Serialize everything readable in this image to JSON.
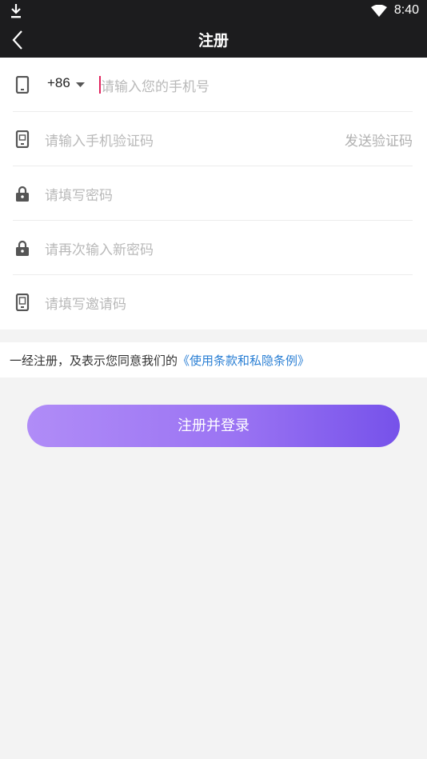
{
  "status_bar": {
    "time": "8:40",
    "icons": [
      "download-icon",
      "wifi-icon"
    ]
  },
  "header": {
    "title": "注册",
    "back_icon": "chevron-left-icon"
  },
  "form": {
    "phone": {
      "icon": "phone-icon",
      "country_code": "+86",
      "placeholder": "请输入您的手机号"
    },
    "sms_code": {
      "icon": "sms-code-icon",
      "placeholder": "请输入手机验证码",
      "send_label": "发送验证码"
    },
    "password": {
      "icon": "lock-icon",
      "placeholder": "请填写密码"
    },
    "confirm_password": {
      "icon": "lock-icon",
      "placeholder": "请再次输入新密码"
    },
    "invite_code": {
      "icon": "invite-code-icon",
      "placeholder": "请填写邀请码"
    }
  },
  "terms": {
    "prefix": "一经注册，及表示您同意我们的",
    "link_text": "《使用条款和私隐条例》"
  },
  "submit": {
    "label": "注册并登录"
  },
  "colors": {
    "header_bg": "#1c1c1e",
    "link": "#2a7fd4",
    "button_gradient_start": "#b08cf7",
    "button_gradient_end": "#7652ea",
    "page_bg": "#f3f3f3"
  }
}
